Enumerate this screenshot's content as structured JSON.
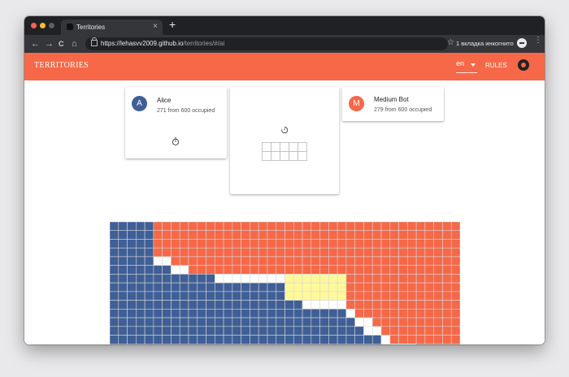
{
  "browser": {
    "tab_title": "Territories",
    "close_glyph": "×",
    "new_tab_glyph": "+",
    "url_host": "https://lehasvv2009.github.io",
    "url_path": "/territories/#/ai",
    "incognito_label": "1 вкладка инкогнито",
    "nav_back": "←",
    "nav_forward": "→",
    "nav_reload": "C",
    "nav_home": "⌂",
    "star_glyph": "☆",
    "menu_glyph": "⋮"
  },
  "app": {
    "brand": "TERRITORIES",
    "language": "en",
    "rules_label": "RULES",
    "accent": "#f66848"
  },
  "players": [
    {
      "initial": "A",
      "name": "Alice",
      "status": "271 from 600 occupied",
      "color": "#3f5f96"
    },
    {
      "initial": "M",
      "name": "Medium Bot",
      "status": "279 from 600 occupied",
      "color": "#f66848"
    }
  ],
  "board": {
    "columns": 40,
    "rows": 15,
    "colors": {
      "blue": "#3f5f96",
      "red": "#f66848",
      "empty": "#ffffff",
      "highlight": "#fff99a",
      "grid": "#d7d7d7"
    }
  },
  "next_piece": {
    "columns": 5,
    "rows": 2
  }
}
